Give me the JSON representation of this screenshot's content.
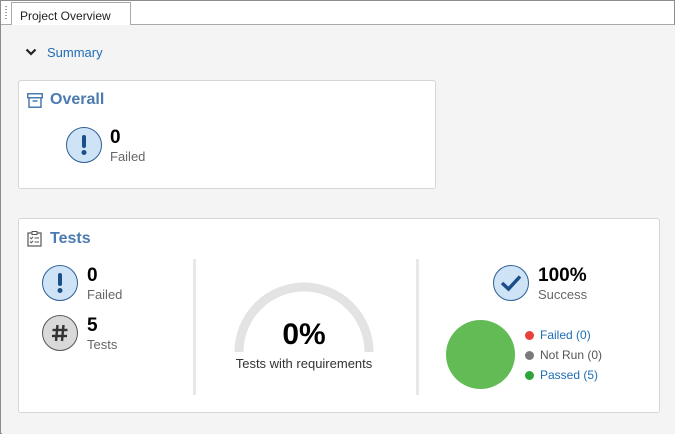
{
  "tabs": [
    {
      "label": "Project Overview"
    }
  ],
  "summary": {
    "label": "Summary"
  },
  "overall": {
    "title": "Overall",
    "failed": {
      "value": "0",
      "label": "Failed"
    }
  },
  "tests": {
    "title": "Tests",
    "failed": {
      "value": "0",
      "label": "Failed"
    },
    "total": {
      "value": "5",
      "label": "Tests"
    },
    "requirements": {
      "value": "0%",
      "label": "Tests with requirements",
      "fraction": 0
    },
    "success": {
      "value": "100%",
      "label": "Success"
    },
    "legend": [
      {
        "label": "Failed (0)",
        "color": "#e8413c",
        "link": true
      },
      {
        "label": "Not Run (0)",
        "color": "#7a7a7a",
        "link": false
      },
      {
        "label": "Passed (5)",
        "color": "#2ea43b",
        "link": true
      }
    ],
    "pie_color": "#62bb55"
  },
  "colors": {
    "accent": "#4b7bb0",
    "link": "#1f6db5",
    "gauge_track": "#e3e3e3"
  },
  "icons": [
    "drag-grip-icon",
    "chevron-down-icon",
    "archive-box-icon",
    "exclamation-icon",
    "checklist-icon",
    "hash-icon",
    "checkmark-icon"
  ]
}
